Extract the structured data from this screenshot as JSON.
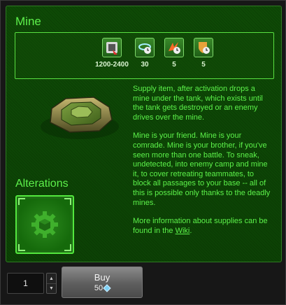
{
  "item": {
    "title": "Mine"
  },
  "properties": [
    {
      "icon": "damage-icon",
      "value": "1200-2400"
    },
    {
      "icon": "activation-radius-icon",
      "value": "30"
    },
    {
      "icon": "impact-force-icon",
      "value": "5"
    },
    {
      "icon": "armor-icon",
      "value": "5"
    }
  ],
  "description": {
    "p1": "Supply item, after activation drops a mine under the tank, which exists until the tank gets destroyed or an enemy drives over the mine.",
    "p2": "Mine is your friend. Mine is your comrade. Mine is your brother, if you've seen more than one battle. To sneak, undetected, into enemy camp and mine it, to cover retreating teammates, to block all passages to your base -- all of this is possible only thanks to the deadly mines.",
    "p3_before": "More information about supplies can be found in the ",
    "p3_link": "Wiki",
    "p3_after": "."
  },
  "alterations": {
    "title": "Alterations",
    "tile_icon": "gear-cube-icon"
  },
  "purchase": {
    "quantity": "1",
    "buy_label": "Buy",
    "price": "50",
    "currency_icon": "crystal-icon"
  },
  "colors": {
    "accent": "#5cf24a",
    "panel_bg": "#0e4a06",
    "button_bg": "#6a6a6a"
  }
}
